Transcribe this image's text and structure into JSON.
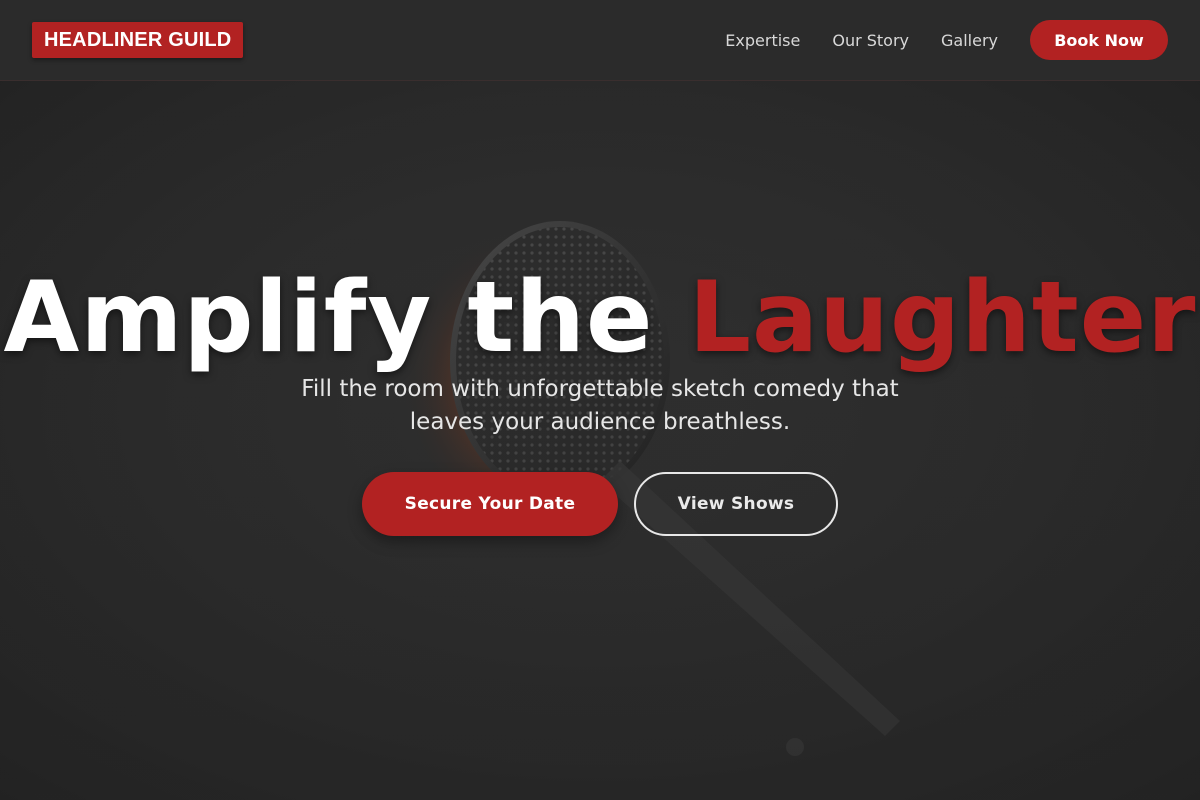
{
  "brand": {
    "name": "HEADLINER GUILD"
  },
  "nav": {
    "links": [
      "Expertise",
      "Our Story",
      "Gallery"
    ],
    "cta_label": "Book Now"
  },
  "hero": {
    "headline_main": "Amplify the",
    "headline_accent": "Laughter",
    "subtitle": "Fill the room with unforgettable sketch comedy that leaves your audience breathless.",
    "primary_button": "Secure Your Date",
    "secondary_button": "View Shows",
    "background_image": "microphone-photo"
  },
  "colors": {
    "accent": "#b22222",
    "background": "#2a2a2a",
    "text": "#ffffff"
  }
}
